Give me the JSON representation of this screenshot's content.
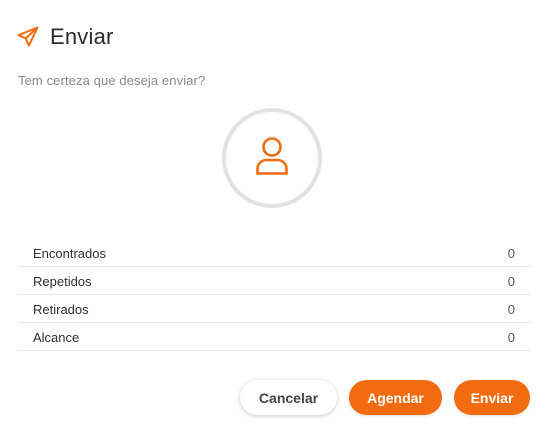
{
  "dialog": {
    "title": "Enviar",
    "subtitle": "Tem certeza que deseja enviar?",
    "title_icon": "send-paper-plane-icon",
    "avatar_icon": "user-icon"
  },
  "stats": [
    {
      "label": "Encontrados",
      "value": "0"
    },
    {
      "label": "Repetidos",
      "value": "0"
    },
    {
      "label": "Retirados",
      "value": "0"
    },
    {
      "label": "Alcance",
      "value": "0"
    }
  ],
  "actions": {
    "cancel_label": "Cancelar",
    "schedule_label": "Agendar",
    "send_label": "Enviar"
  },
  "colors": {
    "accent": "#f26b0f",
    "avatar_ring": "#e2e2e2",
    "divider": "#e6e6e6"
  }
}
